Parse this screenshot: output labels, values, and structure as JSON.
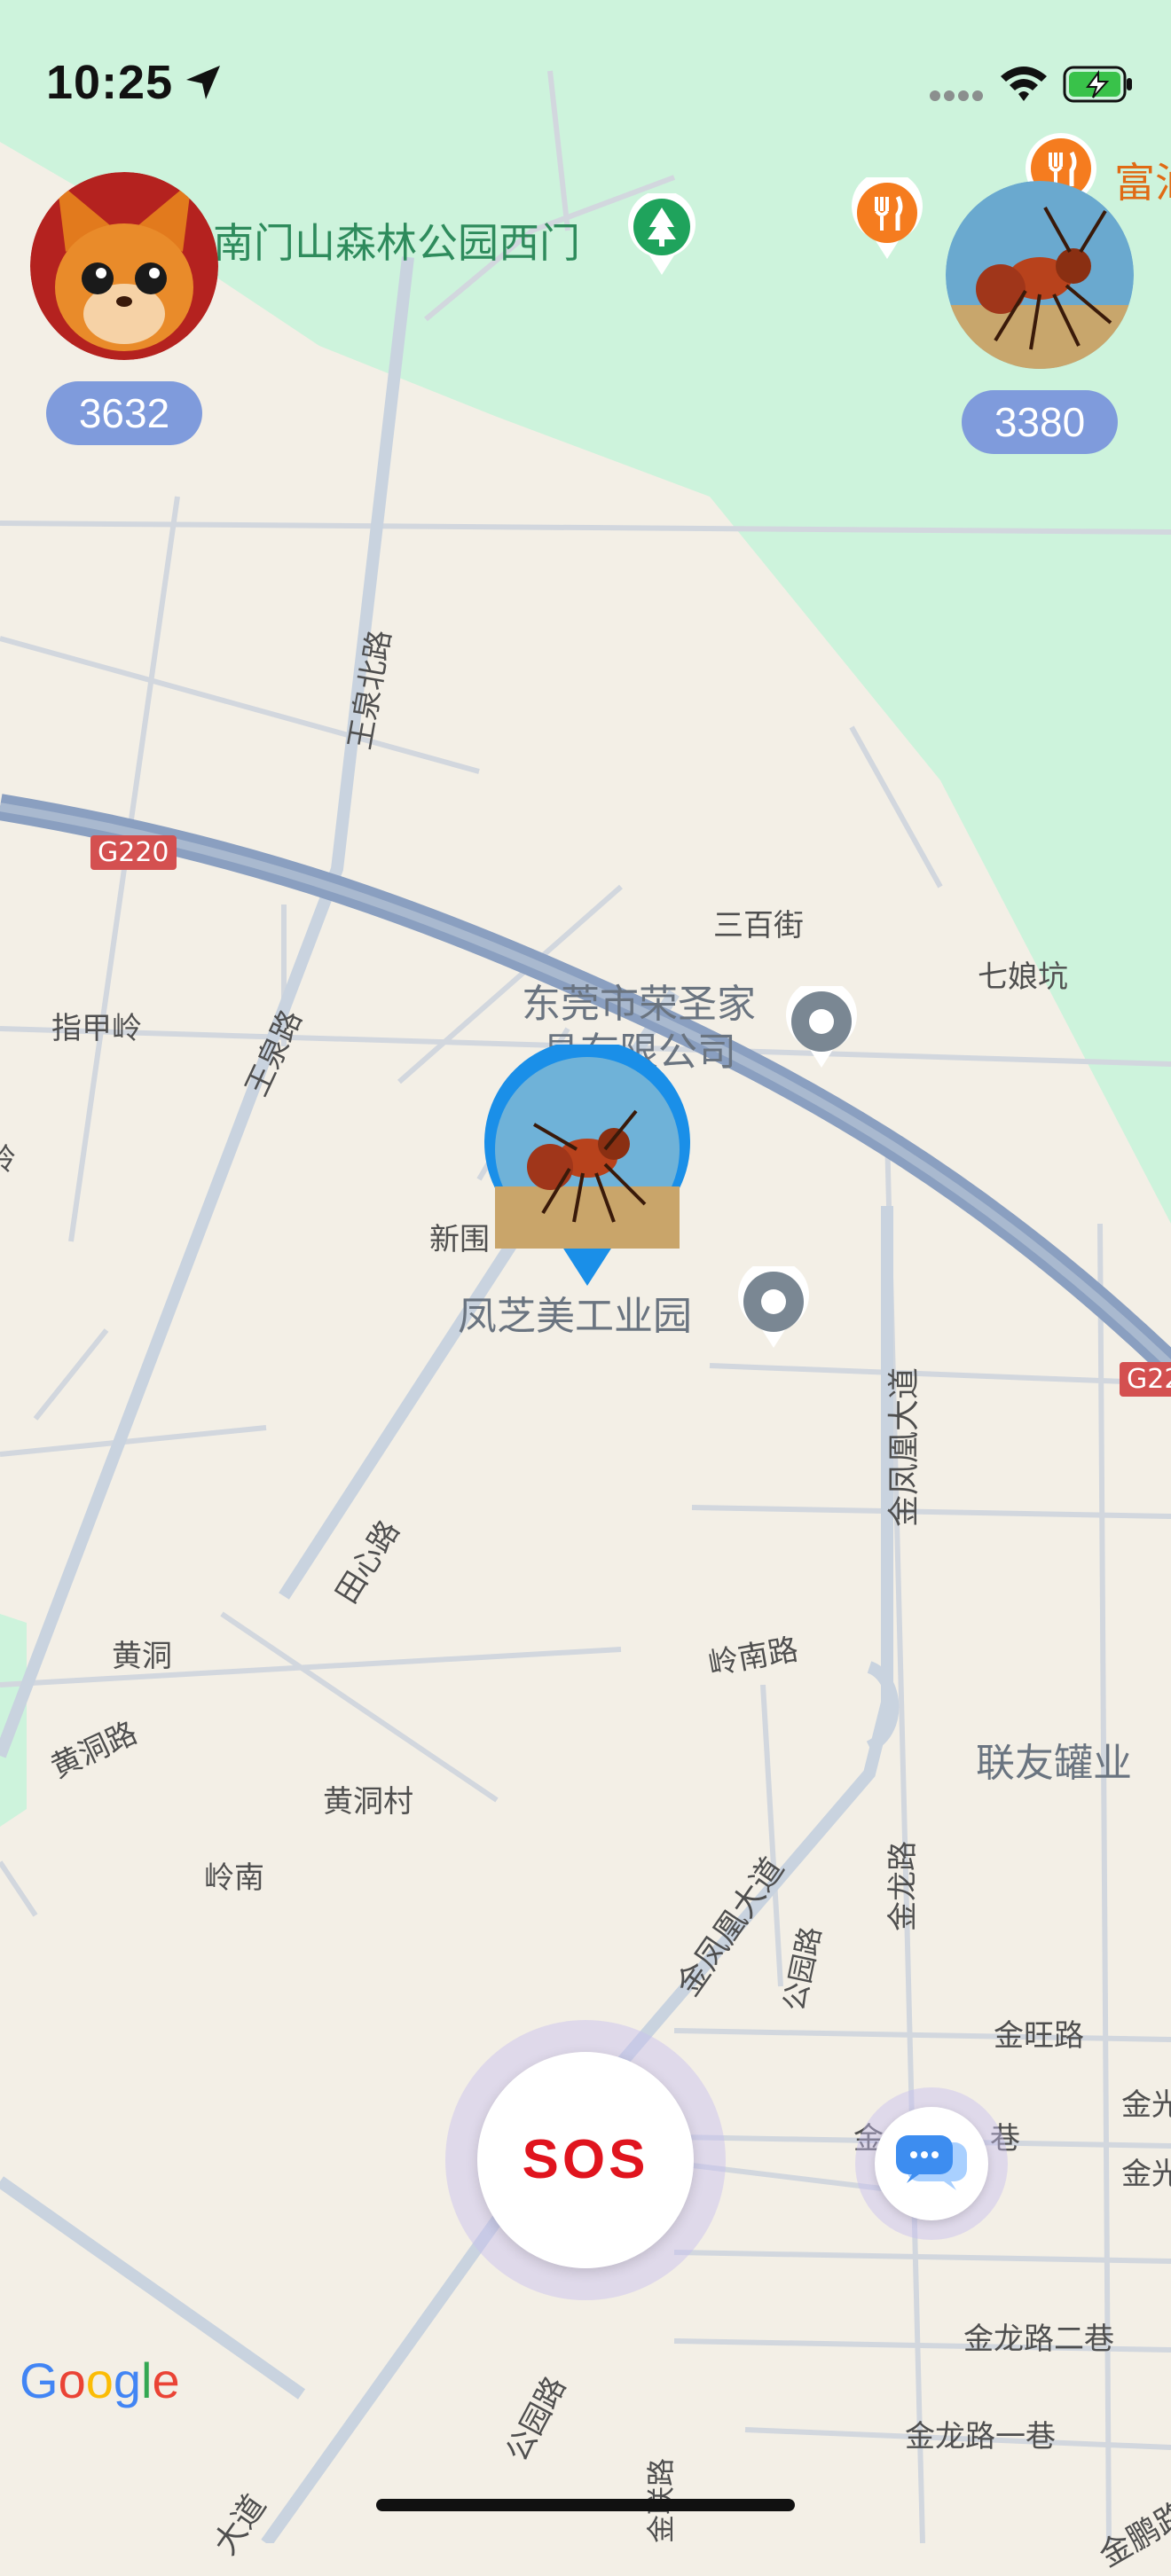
{
  "status_bar": {
    "time": "10:25"
  },
  "players": [
    {
      "name": "fox-player",
      "score": "3632"
    },
    {
      "name": "ant-player",
      "score": "3380"
    }
  ],
  "map": {
    "park_label": "南门山森林公园西门",
    "poi_top_right": "富汕",
    "highway_label": "G220",
    "highway_label_right": "G22",
    "roads": {
      "wangquan_north": "王泉北路",
      "wangquan": "王泉路",
      "tianxin": "田心路",
      "jinfenghuang": "金凤凰大道",
      "jinfenghuang_lower": "金凤凰大道",
      "lingnan": "岭南路",
      "huangdong": "黄洞路",
      "jinlong": "金龙路",
      "gongyuan": "公园路",
      "gongyuan_lower": "公园路",
      "jinwang": "金旺路",
      "jinlong_2": "金龙路二巷",
      "jinlong_1": "金龙路一巷",
      "jinpeng": "金鹏路",
      "jinlian": "金联路",
      "lower_dadao": "大道"
    },
    "places": {
      "sanbai": "三百街",
      "qiniang": "七娘坑",
      "zhijia": "指甲岭",
      "ling_edge": "岭",
      "xinwei": "新围",
      "huangdong": "黄洞",
      "huangdong_village": "黄洞村",
      "lingnan": "岭南",
      "company": "东莞市荣圣家具有限公司",
      "industrial_park": "凤芝美工业园",
      "lianyou": "联友罐业",
      "jin_xiang": "金",
      "xiang": "巷",
      "jin_r1": "金光",
      "jin_r2": "金光"
    }
  },
  "buttons": {
    "sos_label": "SOS"
  },
  "google_logo": "Google",
  "colors": {
    "park": "#cdf3dc",
    "land": "#f3efe6",
    "highway": "#8a9fc0",
    "score_pill": "#7f9bdc",
    "sos_text": "#e0141e",
    "marker": "#1a8fe8",
    "restaurant": "#f57c1f"
  }
}
